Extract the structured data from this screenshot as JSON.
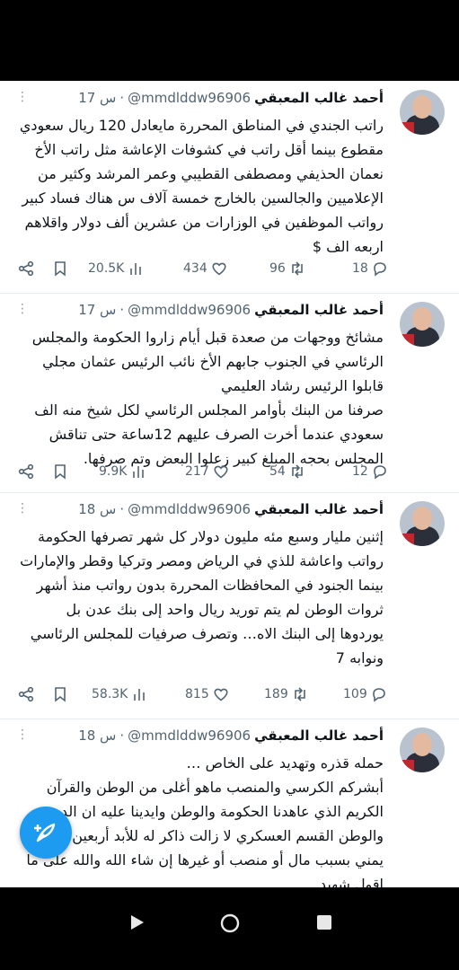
{
  "tweets": [
    {
      "name": "أحمد غالب المعبقي",
      "handle": "@mmdlddw96906",
      "dot": "·",
      "time": "17 س",
      "text": [
        "راتب الجندي في المناطق المحررة مايعادل 120 ريال سعودي مقطوع بينما أقل راتب في كشوفات الإعاشة مثل راتب الأخ نعمان الحذيفي ومصطفى القطيبي وعمر المرشد وكثير من الإعلاميين والجالسين بالخارج خمسة آلاف س هناك فساد كبير رواتب الموظفين في الوزارات من عشرين ألف دولار واقلاهم اربعه الف $"
      ],
      "views": "20.5K",
      "likes": "434",
      "retweets": "96",
      "replies": "18"
    },
    {
      "name": "أحمد غالب المعبقي",
      "handle": "@mmdlddw96906",
      "dot": "·",
      "time": "17 س",
      "text": [
        "مشائخ ووجهات من صعدة قبل أيام زاروا الحكومة والمجلس الرئاسي في الجنوب جابهم الأخ نائب الرئيس عثمان مجلي قابلوا الرئيس رشاد العليمي",
        "صرفنا من البنك بأوامر المجلس الرئاسي لكل شيخ منه الف سعودي عندما أخرت الصرف عليهم 12ساعة حتى تناقش المجلس بحجه المبلغ كبير زعلوا البعض وتم صرفها."
      ],
      "views": "9.9K",
      "likes": "217",
      "retweets": "54",
      "replies": "12"
    },
    {
      "name": "أحمد غالب المعبقي",
      "handle": "@mmdlddw96906",
      "dot": "·",
      "time": "18 س",
      "text": [
        "إثنين مليار وسبع مئه مليون دولار كل شهر تصرفها الحكومة رواتب واعاشة للذي في الرياض ومصر وتركيا وقطر والإمارات بينما الجنود في المحافظات المحررة بدون رواتب منذ أشهر ثروات الوطن لم يتم توريد ريال واحد إلى بنك عدن بل يوردوها إلى البنك الاه… وتصرف صرفيات للمجلس الرئاسي ونوابه 7"
      ],
      "views": "58.3K",
      "likes": "815",
      "retweets": "189",
      "replies": "109"
    },
    {
      "name": "أحمد غالب المعبقي",
      "handle": "@mmdlddw96906",
      "dot": "·",
      "time": "18 س",
      "text": [
        "حمله قذره وتهديد على الخاص …",
        "أبشركم الكرسي والمنصب ماهو أغلى من الوطن والقرآن الكريم الذي عاهدنا الحكومة والوطن وايدينا عليه ان الدين والوطن القسم العسكري لا زالت ذاكر له للأبد أربعين مليون يمني بسبب مال أو منصب أو غيرها إن شاء الله والله على ما اقول شهيد"
      ]
    }
  ]
}
